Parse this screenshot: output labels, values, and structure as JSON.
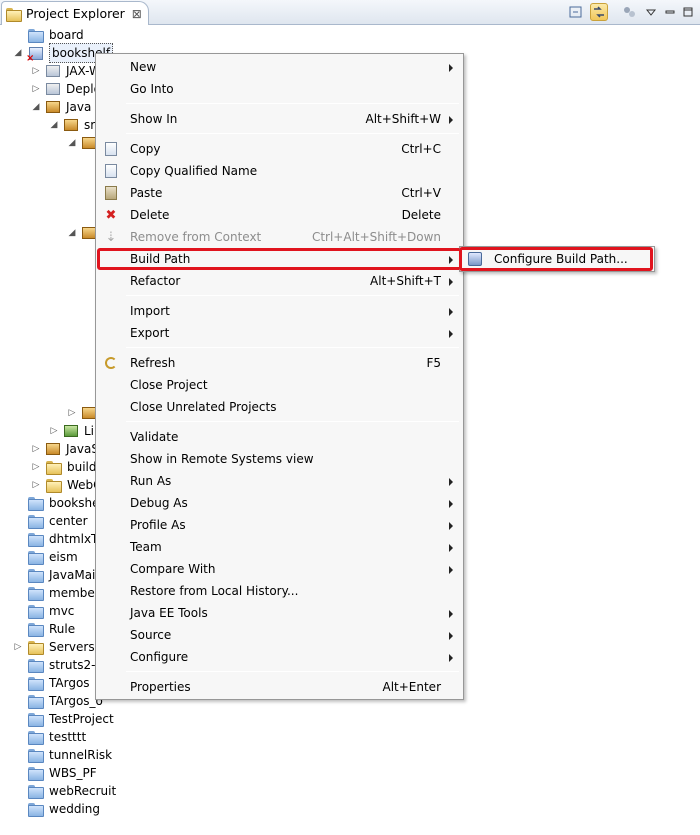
{
  "view": {
    "tab_title": "Project Explorer",
    "close_glyph": "⊠"
  },
  "tree": {
    "items": [
      {
        "label": "board",
        "icon": "folder-icon"
      },
      {
        "label": "bookshelf",
        "icon": "project-icon",
        "selected": true
      },
      {
        "label": "JAX-W",
        "icon": "web-services-icon"
      },
      {
        "label": "Deplo",
        "icon": "deployment-icon"
      },
      {
        "label": "Java R",
        "icon": "java-resources-icon"
      },
      {
        "label": "sr",
        "icon": "source-folder-icon"
      },
      {
        "label": "Li",
        "icon": "libraries-icon"
      },
      {
        "label": "JavaS",
        "icon": "javascript-icon"
      },
      {
        "label": "build",
        "icon": "folder-icon"
      },
      {
        "label": "WebC",
        "icon": "folder-icon"
      },
      {
        "label": "bookshel",
        "icon": "folder-icon"
      },
      {
        "label": "center",
        "icon": "folder-icon"
      },
      {
        "label": "dhtmlxTe",
        "icon": "folder-icon"
      },
      {
        "label": "eism",
        "icon": "folder-icon"
      },
      {
        "label": "JavaMail",
        "icon": "folder-icon"
      },
      {
        "label": "member2",
        "icon": "folder-icon"
      },
      {
        "label": "mvc",
        "icon": "folder-icon"
      },
      {
        "label": "Rule",
        "icon": "folder-icon"
      },
      {
        "label": "Servers",
        "icon": "folder-icon"
      },
      {
        "label": "struts2-b",
        "icon": "folder-icon"
      },
      {
        "label": "TArgos",
        "icon": "folder-icon"
      },
      {
        "label": "TArgos_o",
        "icon": "folder-icon"
      },
      {
        "label": "TestProject",
        "icon": "folder-icon"
      },
      {
        "label": "testttt",
        "icon": "folder-icon"
      },
      {
        "label": "tunnelRisk",
        "icon": "folder-icon"
      },
      {
        "label": "WBS_PF",
        "icon": "folder-icon"
      },
      {
        "label": "webRecruit",
        "icon": "folder-icon"
      },
      {
        "label": "wedding",
        "icon": "folder-icon"
      }
    ]
  },
  "menu": {
    "new": {
      "label": "New"
    },
    "go_into": {
      "label": "Go Into"
    },
    "show_in": {
      "label": "Show In",
      "shortcut": "Alt+Shift+W"
    },
    "copy": {
      "label": "Copy",
      "shortcut": "Ctrl+C"
    },
    "copy_qualified": {
      "label": "Copy Qualified Name"
    },
    "paste": {
      "label": "Paste",
      "shortcut": "Ctrl+V"
    },
    "delete": {
      "label": "Delete",
      "shortcut": "Delete"
    },
    "remove_context": {
      "label": "Remove from Context",
      "shortcut": "Ctrl+Alt+Shift+Down"
    },
    "build_path": {
      "label": "Build Path"
    },
    "refactor": {
      "label": "Refactor",
      "shortcut": "Alt+Shift+T"
    },
    "import": {
      "label": "Import"
    },
    "export": {
      "label": "Export"
    },
    "refresh": {
      "label": "Refresh",
      "shortcut": "F5"
    },
    "close_project": {
      "label": "Close Project"
    },
    "close_unrelated": {
      "label": "Close Unrelated Projects"
    },
    "validate": {
      "label": "Validate"
    },
    "show_remote": {
      "label": "Show in Remote Systems view"
    },
    "run_as": {
      "label": "Run As"
    },
    "debug_as": {
      "label": "Debug As"
    },
    "profile_as": {
      "label": "Profile As"
    },
    "team": {
      "label": "Team"
    },
    "compare_with": {
      "label": "Compare With"
    },
    "restore_history": {
      "label": "Restore from Local History..."
    },
    "java_ee_tools": {
      "label": "Java EE Tools"
    },
    "source": {
      "label": "Source"
    },
    "configure": {
      "label": "Configure"
    },
    "properties": {
      "label": "Properties",
      "shortcut": "Alt+Enter"
    }
  },
  "submenu": {
    "configure_build_path": {
      "label": "Configure Build Path..."
    }
  },
  "colors": {
    "highlight_border": "#e0141e",
    "menu_bg": "#f7f7f7"
  }
}
